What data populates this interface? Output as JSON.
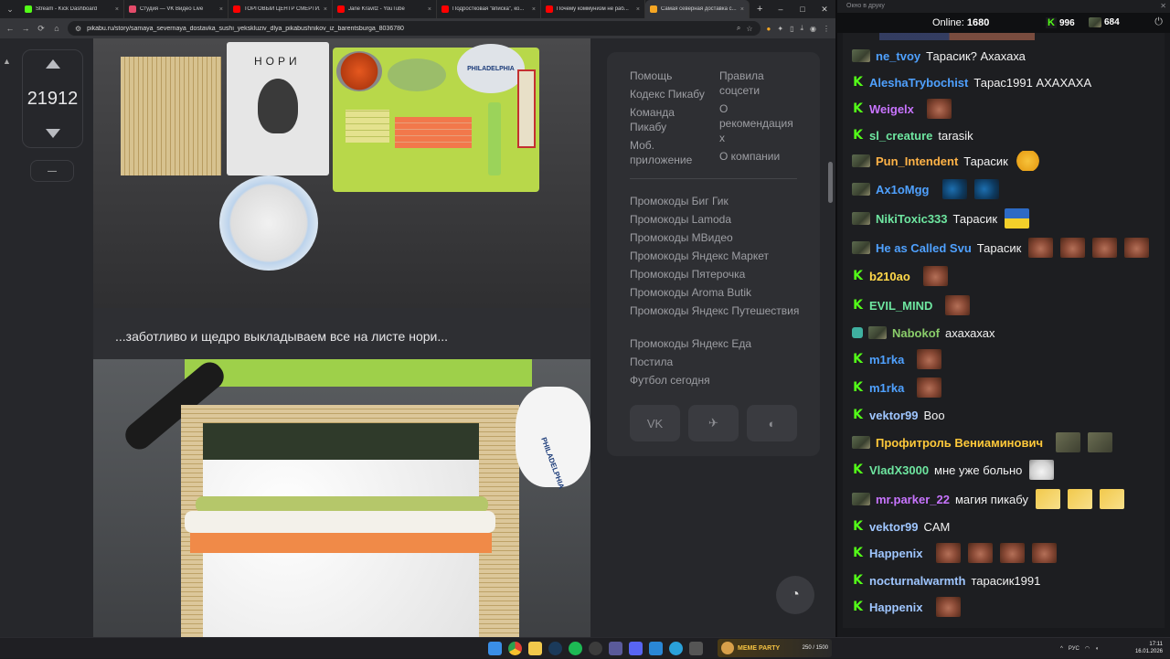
{
  "browser": {
    "tabs": [
      {
        "title": "Stream - Kick Dashboard",
        "color": "#53fc18"
      },
      {
        "title": "Студия — VK Видео Live",
        "color": "#e34b6a"
      },
      {
        "title": "ТОРГОВЫЙ ЦЕНТР СМЕРТИ...",
        "color": "#ff0000"
      },
      {
        "title": "Jane Kravitz - YouTube",
        "color": "#ff0000"
      },
      {
        "title": "Подростковая \"вписка\", ко...",
        "color": "#ff0000"
      },
      {
        "title": "Почему коммунизм не раб...",
        "color": "#ff0000"
      },
      {
        "title": "Самая северная доставка с...",
        "color": "#f6a623"
      }
    ],
    "tab_close": "×",
    "new_tab": "+",
    "url": "pikabu.ru/story/samaya_severnaya_dostavka_sushi_yekskluziv_dlya_pikabushnikov_iz_barentsburga_8036780",
    "win_min": "–",
    "win_max": "□",
    "win_close": "✕"
  },
  "post": {
    "rating": "21912",
    "dash": "—",
    "caption": "...заботливо и щедро выкладываем все на листе нори...",
    "img1_nori_label": "НОРИ",
    "img1_cheese_label": "PHILADELPHIA",
    "img2_cheese_label": "PHILADELPHIA"
  },
  "sidebar": {
    "col1": [
      "Помощь",
      "Кодекс Пикабу",
      "Команда Пикабу",
      "Моб. приложение"
    ],
    "col2": [
      "Правила соцсети",
      "О рекомендация х",
      "О компании"
    ],
    "promos": [
      "Промокоды Биг Гик",
      "Промокоды Lamoda",
      "Промокоды МВидео",
      "Промокоды Яндекс Маркет",
      "Промокоды Пятерочка",
      "Промокоды Aroma Butik",
      "Промокоды Яндекс Путешествия",
      "Промокоды Яндекс Еда",
      "Постила",
      "Футбол сегодня"
    ],
    "social": [
      "VK",
      "✈",
      "◐"
    ]
  },
  "chat": {
    "window_title": "Окно в друку",
    "online_label": "Online:",
    "online_count": "1680",
    "kick_count": "996",
    "other_count": "684",
    "messages": [
      {
        "badge": "av",
        "user": "ne_tvoy",
        "color": "#4fa1ff",
        "text": "Тарасик? Ахахаха",
        "emotes": []
      },
      {
        "badge": "k",
        "user": "AleshaTrybochist",
        "color": "#4fa1ff",
        "text": "Тарас1991 АХАХАХА",
        "emotes": []
      },
      {
        "badge": "k",
        "user": "Weigelx",
        "color": "#c874ff",
        "text": "",
        "emotes": [
          "face"
        ]
      },
      {
        "badge": "k",
        "user": "sl_creature",
        "color": "#6ee6a0",
        "text": "tarasik",
        "emotes": []
      },
      {
        "badge": "av",
        "user": "Pun_Intendent",
        "color": "#ffb347",
        "text": "Тарасик",
        "emotes": [
          "laugh"
        ]
      },
      {
        "badge": "av",
        "user": "Ax1oMgg",
        "color": "#4fa1ff",
        "text": "",
        "emotes": [
          "blue",
          "blue"
        ]
      },
      {
        "badge": "av",
        "user": "NikiToxic333",
        "color": "#6ee6a0",
        "text": "Тарасик",
        "emotes": [
          "ua"
        ]
      },
      {
        "badge": "av",
        "user": "He as Called Svu",
        "color": "#4fa1ff",
        "text": "Тарасик",
        "emotes": [
          "face",
          "face",
          "face",
          "face"
        ]
      },
      {
        "badge": "k",
        "user": "b210ao",
        "color": "#ffd84a",
        "text": "",
        "emotes": [
          "face"
        ]
      },
      {
        "badge": "k",
        "user": "EVIL_MIND",
        "color": "#6ee6a0",
        "text": "",
        "emotes": [
          "face"
        ]
      },
      {
        "badge": "shield",
        "user": "Nabokof",
        "color": "#8acd6a",
        "text": "ахахахах",
        "emotes": []
      },
      {
        "badge": "k",
        "user": "m1rka",
        "color": "#4fa1ff",
        "text": "",
        "emotes": [
          "face"
        ]
      },
      {
        "badge": "k",
        "user": "m1rka",
        "color": "#4fa1ff",
        "text": "",
        "emotes": [
          "face"
        ]
      },
      {
        "badge": "k",
        "user": "vektor99",
        "color": "#9fc6ff",
        "text": "Boo",
        "emotes": []
      },
      {
        "badge": "av",
        "user": "Профитроль Вениаминович",
        "color": "#ffc93a",
        "text": "",
        "emotes": [
          "man",
          "man"
        ]
      },
      {
        "badge": "k",
        "user": "VladX3000",
        "color": "#6ee6a0",
        "text": "мне уже больно",
        "emotes": [
          "cat"
        ]
      },
      {
        "badge": "av",
        "user": "mr.parker_22",
        "color": "#c874ff",
        "text": "магия пикабу",
        "emotes": [
          "smug",
          "smug",
          "smug"
        ]
      },
      {
        "badge": "k",
        "user": "vektor99",
        "color": "#9fc6ff",
        "text": "CAM",
        "emotes": []
      },
      {
        "badge": "k",
        "user": "Happenix",
        "color": "#9fc6ff",
        "text": "",
        "emotes": [
          "face",
          "face",
          "face",
          "face"
        ]
      },
      {
        "badge": "k",
        "user": "nocturnalwarmth",
        "color": "#9fc6ff",
        "text": "тарасик1991",
        "emotes": []
      },
      {
        "badge": "k",
        "user": "Happenix",
        "color": "#9fc6ff",
        "text": "",
        "emotes": [
          "face"
        ]
      }
    ]
  },
  "taskbar": {
    "meme_title": "MEME PARTY",
    "meme_progress": "250 / 1500",
    "lang": "РУС",
    "time": "17:11",
    "date": "16.01.2026"
  }
}
